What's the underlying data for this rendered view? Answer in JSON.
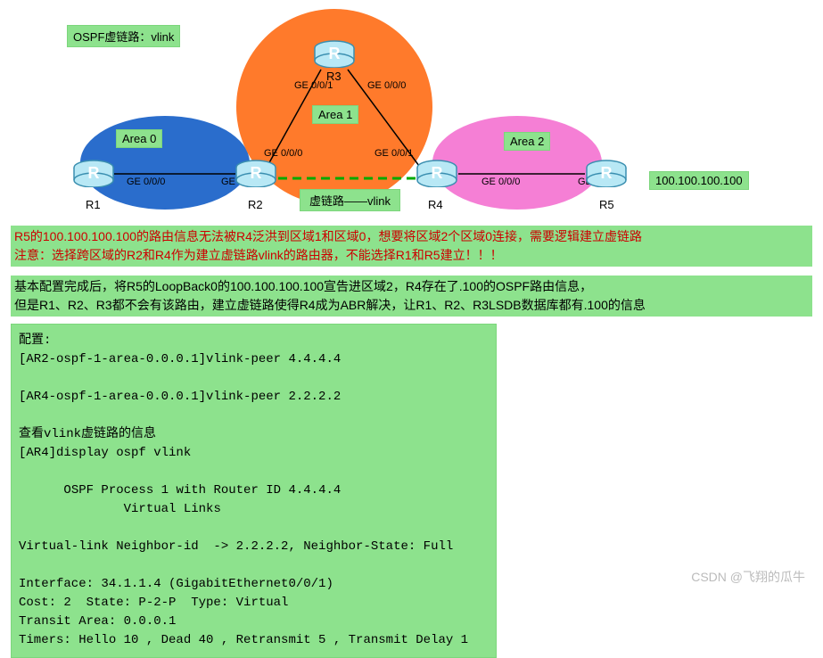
{
  "title": "OSPF虚链路：vlink",
  "areas": {
    "a0": "Area 0",
    "a1": "Area 1",
    "a2": "Area 2"
  },
  "vlink_label": "虚链路——vlink",
  "ip_label": "100.100.100.100",
  "routers": {
    "r1": "R1",
    "r2": "R2",
    "r3": "R3",
    "r4": "R4",
    "r5": "R5"
  },
  "interfaces": {
    "r1_ge": "GE 0/0/0",
    "r2_ge0": "GE 0/0/1",
    "r2_ge1": "GE 0/0/0",
    "r3_ge1": "GE 0/0/1",
    "r3_ge0": "GE 0/0/0",
    "r4_ge1": "GE 0/0/1",
    "r4_ge0": "GE 0/0/0",
    "r5_ge": "GE 0/0/1"
  },
  "red_text": "R5的100.100.100.100的路由信息无法被R4泛洪到区域1和区域0，想要将区域2个区域0连接，需要逻辑建立虚链路\n注意：选择跨区域的R2和R4作为建立虚链路vlink的路由器，不能选择R1和R5建立！！！",
  "info_text": "基本配置完成后，将R5的LoopBack0的100.100.100.100宣告进区域2，R4存在了.100的OSPF路由信息，\n但是R1、R2、R3都不会有该路由，建立虚链路使得R4成为ABR解决，让R1、R2、R3LSDB数据库都有.100的信息",
  "config_title": "配置:",
  "config_lines": "[AR2-ospf-1-area-0.0.0.1]vlink-peer 4.4.4.4\n\n[AR4-ospf-1-area-0.0.0.1]vlink-peer 2.2.2.2\n\n查看vlink虚链路的信息\n[AR4]display ospf vlink\n\n      OSPF Process 1 with Router ID 4.4.4.4\n              Virtual Links\n\nVirtual-link Neighbor-id  -> 2.2.2.2, Neighbor-State: Full\n\nInterface: 34.1.1.4 (GigabitEthernet0/0/1)\nCost: 2  State: P-2-P  Type: Virtual\nTransit Area: 0.0.0.1\nTimers: Hello 10 , Dead 40 , Retransmit 5 , Transmit Delay 1",
  "watermark": "CSDN @飞翔的瓜牛"
}
